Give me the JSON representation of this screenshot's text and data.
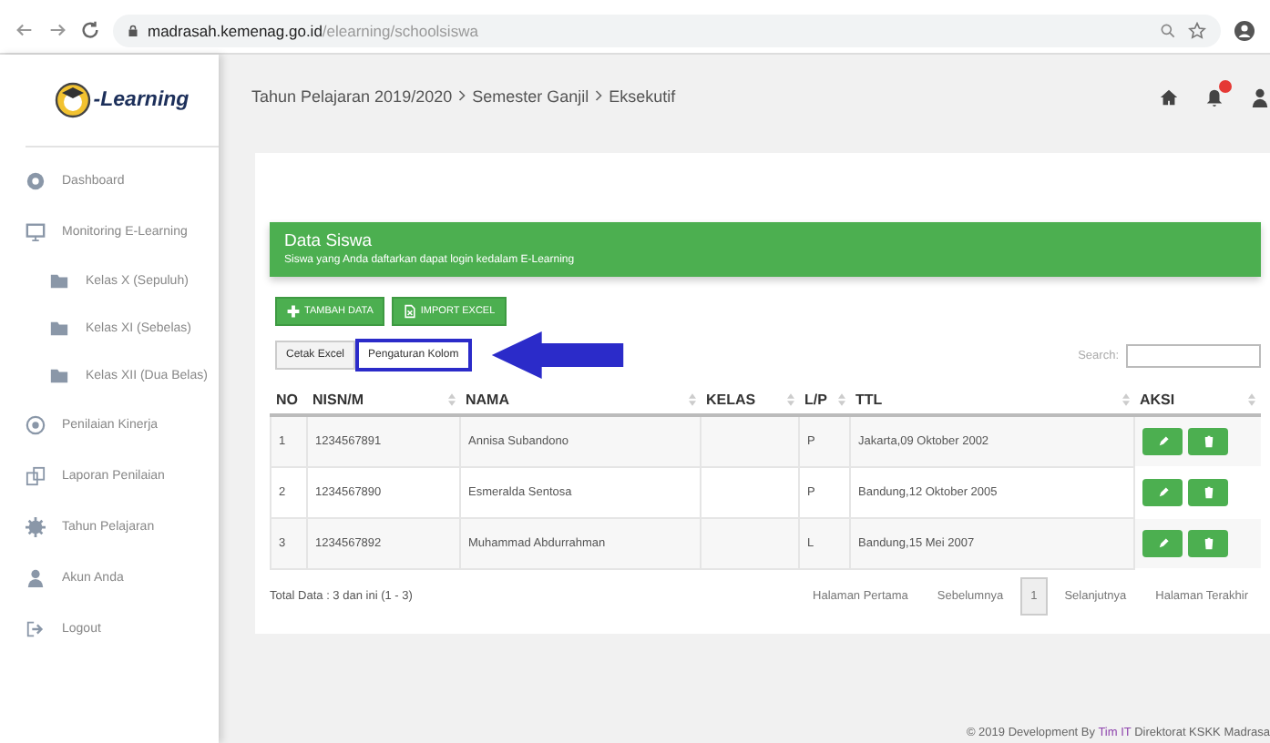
{
  "browser": {
    "url_host": "madrasah.kemenag.go.id",
    "url_path": "/elearning/schoolsiswa"
  },
  "logo": {
    "text": "-Learning"
  },
  "sidebar": {
    "items": [
      {
        "label": "Dashboard"
      },
      {
        "label": "Monitoring E-Learning",
        "children": [
          {
            "label": "Kelas X (Sepuluh)"
          },
          {
            "label": "Kelas XI (Sebelas)"
          },
          {
            "label": "Kelas XII (Dua Belas)"
          }
        ]
      },
      {
        "label": "Penilaian Kinerja"
      },
      {
        "label": "Laporan Penilaian"
      },
      {
        "label": "Tahun Pelajaran"
      },
      {
        "label": "Akun Anda"
      },
      {
        "label": "Logout"
      }
    ]
  },
  "breadcrumb": [
    "Tahun Pelajaran 2019/2020",
    "Semester Ganjil",
    "Eksekutif"
  ],
  "panel": {
    "title": "Data Siswa",
    "subtitle": "Siswa yang Anda daftarkan dapat login kedalam E-Learning"
  },
  "actions": [
    {
      "label": "TAMBAH DATA"
    },
    {
      "label": "IMPORT EXCEL"
    }
  ],
  "tools": [
    {
      "label": "Cetak Excel",
      "highlighted": false
    },
    {
      "label": "Pengaturan Kolom",
      "highlighted": true
    }
  ],
  "search": {
    "label": "Search:"
  },
  "table": {
    "columns": [
      {
        "label": "NO",
        "sortable": false
      },
      {
        "label": "NISN/M",
        "sortable": true
      },
      {
        "label": "NAMA",
        "sortable": true
      },
      {
        "label": "KELAS",
        "sortable": true
      },
      {
        "label": "L/P",
        "sortable": true
      },
      {
        "label": "TTL",
        "sortable": true
      },
      {
        "label": "AKSI",
        "sortable": true
      }
    ],
    "rows": [
      [
        "1",
        "1234567891",
        "Annisa Subandono",
        "",
        "P",
        "Jakarta,09 Oktober 2002"
      ],
      [
        "2",
        "1234567890",
        "Esmeralda Sentosa",
        "",
        "P",
        "Bandung,12 Oktober 2005"
      ],
      [
        "3",
        "1234567892",
        "Muhammad Abdurrahman",
        "",
        "L",
        "Bandung,15 Mei 2007"
      ]
    ]
  },
  "total": "Total Data : 3 dan ini (1 - 3)",
  "pagination": [
    {
      "label": "Halaman Pertama",
      "selected": false
    },
    {
      "label": "Sebelumnya",
      "selected": false
    },
    {
      "label": "1",
      "selected": true
    },
    {
      "label": "Selanjutnya",
      "selected": false
    },
    {
      "label": "Halaman Terakhir",
      "selected": false
    }
  ],
  "footer": {
    "prefix": "© 2019 Development By ",
    "link": "Tim IT",
    "suffix": " Direktorat KSKK Madrasa"
  }
}
